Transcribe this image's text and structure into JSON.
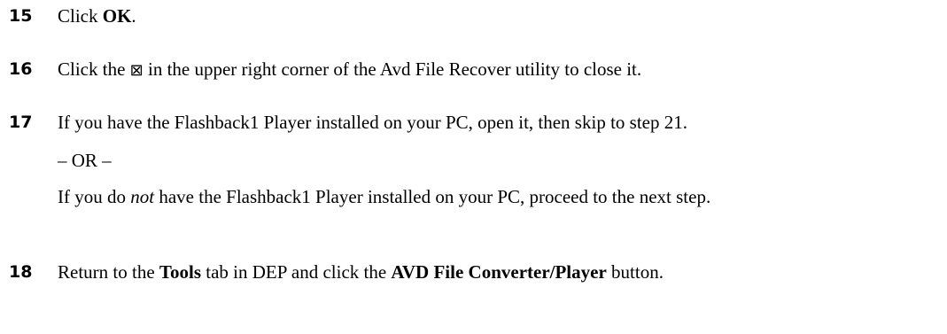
{
  "steps": {
    "s15": {
      "number": "15",
      "pre": "Click ",
      "bold": "OK",
      "post": "."
    },
    "s16": {
      "number": "16",
      "pre": "Click the ",
      "symbol": "⊠",
      "post": " in the upper right corner of the Avd File Recover utility to close it."
    },
    "s17": {
      "number": "17",
      "line1": "If you have the Flashback1 Player installed on your PC, open it, then skip to step 21.",
      "or": "– OR –",
      "alt_pre": "If you do ",
      "alt_em": "not",
      "alt_post": " have the Flashback1 Player installed on your PC, proceed to the next step."
    },
    "s18": {
      "number": "18",
      "pre": "Return to the ",
      "bold1": "Tools",
      "mid": " tab in DEP and click the ",
      "bold2": "AVD File Converter/Player",
      "post": " button."
    }
  }
}
